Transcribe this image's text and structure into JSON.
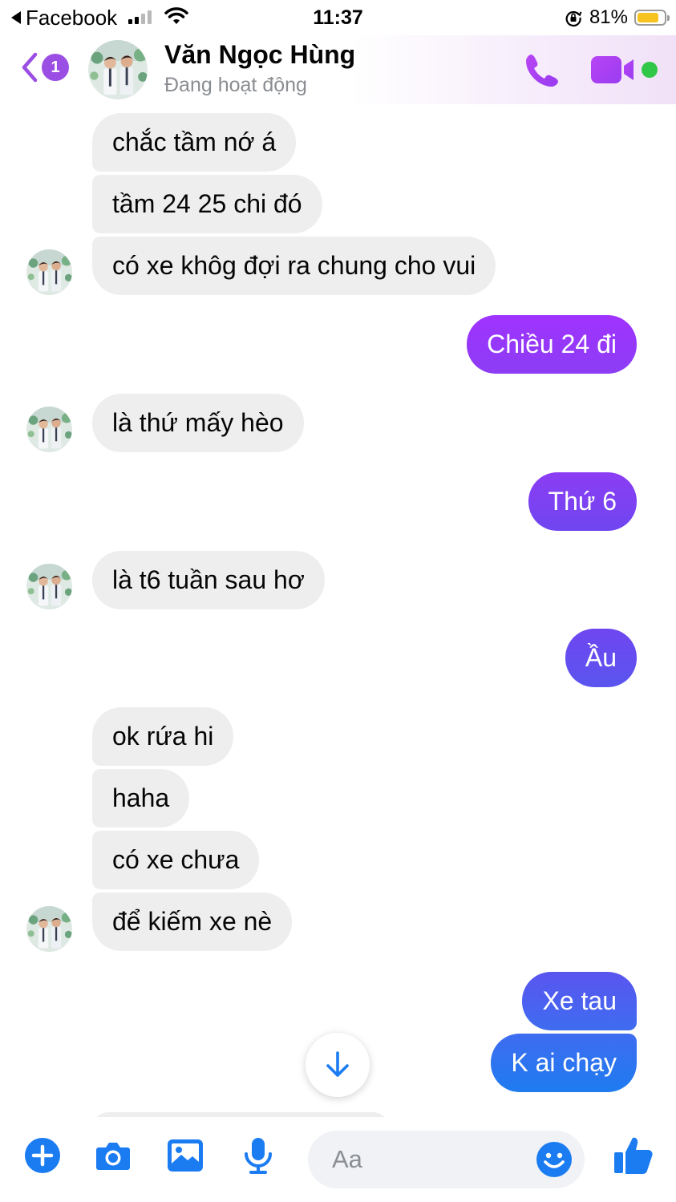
{
  "status_bar": {
    "back_app": "Facebook",
    "time": "11:37",
    "battery": "81%",
    "battery_level": 0.81,
    "signal_bars_filled": 2,
    "signal_bars_total": 4
  },
  "header": {
    "unread_count": "1",
    "contact_name": "Văn Ngọc Hùng",
    "contact_status": "Đang hoạt động",
    "icons": [
      "chevron-left-icon",
      "phone-icon",
      "video-camera-icon",
      "online-dot"
    ],
    "accent_color": "#a033ff"
  },
  "messages": [
    {
      "from": "them",
      "text": "chắc tầm nớ á"
    },
    {
      "from": "them",
      "text": "tầm 24 25 chi đó"
    },
    {
      "from": "them",
      "text": "có xe khôg đợi ra chung cho vui"
    },
    {
      "from": "me",
      "text": "Chiều 24 đi"
    },
    {
      "from": "them",
      "text": "là thứ mấy hèo"
    },
    {
      "from": "me",
      "text": "Thứ 6"
    },
    {
      "from": "them",
      "text": "là t6 tuần sau hơ"
    },
    {
      "from": "me",
      "text": "Ầu"
    },
    {
      "from": "them",
      "text": "ok rứa hi"
    },
    {
      "from": "them",
      "text": "haha"
    },
    {
      "from": "them",
      "text": "có xe chưa"
    },
    {
      "from": "them",
      "text": "để kiếm xe nè"
    },
    {
      "from": "me",
      "text": "Xe tau"
    },
    {
      "from": "me",
      "text": "K ai chạy"
    }
  ],
  "bubble_colors": {
    "incoming": "#eeeeef",
    "outgoing_gradient": [
      "#a033ff",
      "#8c3df4",
      "#6f46f0",
      "#5a55ef",
      "#3e6cf0",
      "#1f7cf0"
    ]
  },
  "composer": {
    "placeholder": "Aa",
    "icons": [
      "plus-icon",
      "camera-icon",
      "image-icon",
      "microphone-icon",
      "emoji-icon",
      "thumbs-up-icon"
    ],
    "icon_color": "#1b7cf2"
  }
}
